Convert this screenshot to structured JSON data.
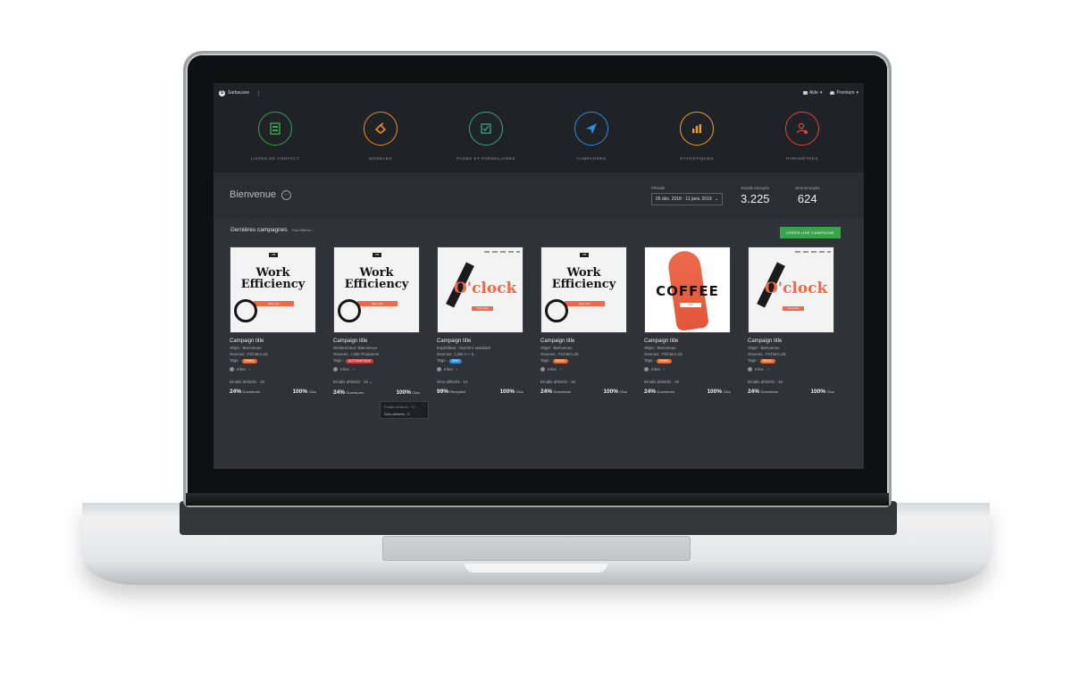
{
  "topbar": {
    "brand": "Sarbacane",
    "brand_initial": "S",
    "menu_dots": "⋮",
    "help_label": "Aide",
    "account_label": "Premium",
    "caret": "▾"
  },
  "modules": [
    {
      "label": "Listes de contact",
      "color": "#3aa34b",
      "icon": "contacts-icon"
    },
    {
      "label": "Modèles",
      "color": "#f08a24",
      "icon": "templates-icon"
    },
    {
      "label": "Pages et formulaires",
      "color": "#3aa38a",
      "icon": "forms-icon"
    },
    {
      "label": "Campagnes",
      "color": "#2b8ee0",
      "icon": "send-icon"
    },
    {
      "label": "Statistiques",
      "color": "#e9a12a",
      "icon": "stats-icon"
    },
    {
      "label": "Paramètres",
      "color": "#e0463d",
      "icon": "settings-icon"
    }
  ],
  "welcome": {
    "title": "Bienvenue",
    "more": "···",
    "period_label": "Période",
    "period_value": "05 déc. 2018 · 11 janv. 2019",
    "period_caret": "⌄",
    "emails_sent_label": "Emails envoyés",
    "emails_sent_value": "3.225",
    "sms_sent_label": "Sms Envoyés",
    "sms_sent_value": "624"
  },
  "campaigns": {
    "title": "Dernières campagnes",
    "see_all": "Tout afficher ›",
    "create_button": "Créer une campagne",
    "cards": [
      {
        "title": "Campaign title",
        "line1": "Objet : Bienvenue",
        "line2": "Sources : Fichiers.xls",
        "tags_label": "Tags :",
        "tag": "EMAIL",
        "tag_color": "#ee6a2f",
        "infos": "Infos",
        "delivered": "Emails délivrés : 10",
        "m1_value": "24%",
        "m1_label": "Ouvertures",
        "m2_value": "100%",
        "m2_label": "Clics",
        "thumb_l1": "Work",
        "thumb_l2": "Efficiency",
        "thumb_cta": "More Info"
      },
      {
        "title": "Campaign title",
        "line1": "Déclencheur: Bienvenue",
        "line2": "Sources : Liste Prospects",
        "tags_label": "Tags :",
        "tag": "AUTOMATIQUE",
        "tag_color": "#d63a3a",
        "infos": "Infos",
        "delivered": "Emails délivrés : 10",
        "m1_value": "24%",
        "m1_label": "Ouvertures",
        "m2_value": "100%",
        "m2_label": "Clics",
        "thumb_l1": "Work",
        "thumb_l2": "Efficiency",
        "thumb_cta": "More Info"
      },
      {
        "title": "Campaign title",
        "line1": "Expéditeur : Numéro standard",
        "line2": "Sources : Liste A + 2...",
        "tags_label": "Tags :",
        "tag": "SMS",
        "tag_color": "#2b8ee0",
        "infos": "Infos",
        "delivered": "Sms délivrés : 10",
        "m1_value": "99%",
        "m1_label": "Réception",
        "m2_value": "100%",
        "m2_label": "Clics",
        "thumb_l1": "O'clock",
        "thumb_cta": "Voir produit"
      },
      {
        "title": "Campaign title",
        "line1": "Objet : Bienvenue",
        "line2": "Sources : Fichiers.xls",
        "tags_label": "Tags :",
        "tag": "EMAIL",
        "tag_color": "#ee6a2f",
        "infos": "Infos",
        "delivered": "Emails délivrés : 10",
        "m1_value": "24%",
        "m1_label": "Ouvertures",
        "m2_value": "100%",
        "m2_label": "Clics",
        "thumb_l1": "Work",
        "thumb_l2": "Efficiency",
        "thumb_cta": "More Info"
      },
      {
        "title": "Campaign title",
        "line1": "Objet : Bienvenue",
        "line2": "Sources : Fichiers.xls",
        "tags_label": "Tags :",
        "tag": "EMAIL",
        "tag_color": "#ee6a2f",
        "infos": "Infos",
        "delivered": "Emails délivrés : 10",
        "m1_value": "24%",
        "m1_label": "Ouvertures",
        "m2_value": "100%",
        "m2_label": "Clics",
        "thumb_l1": "COFFEE",
        "thumb_cta": "Order"
      },
      {
        "title": "Campaign title",
        "line1": "Objet : Bienvenue",
        "line2": "Sources : Fichiers.xls",
        "tags_label": "Tags :",
        "tag": "EMAIL",
        "tag_color": "#ee6a2f",
        "infos": "Infos",
        "delivered": "Emails délivrés : 10",
        "m1_value": "24%",
        "m1_label": "Ouvertures",
        "m2_value": "100%",
        "m2_label": "Clics",
        "thumb_l1": "O'clock",
        "thumb_cta": "Voir produit"
      }
    ],
    "dropdown": {
      "item1": "Emails délivrés : 10",
      "item2": "Sms délivrés : 2"
    }
  }
}
